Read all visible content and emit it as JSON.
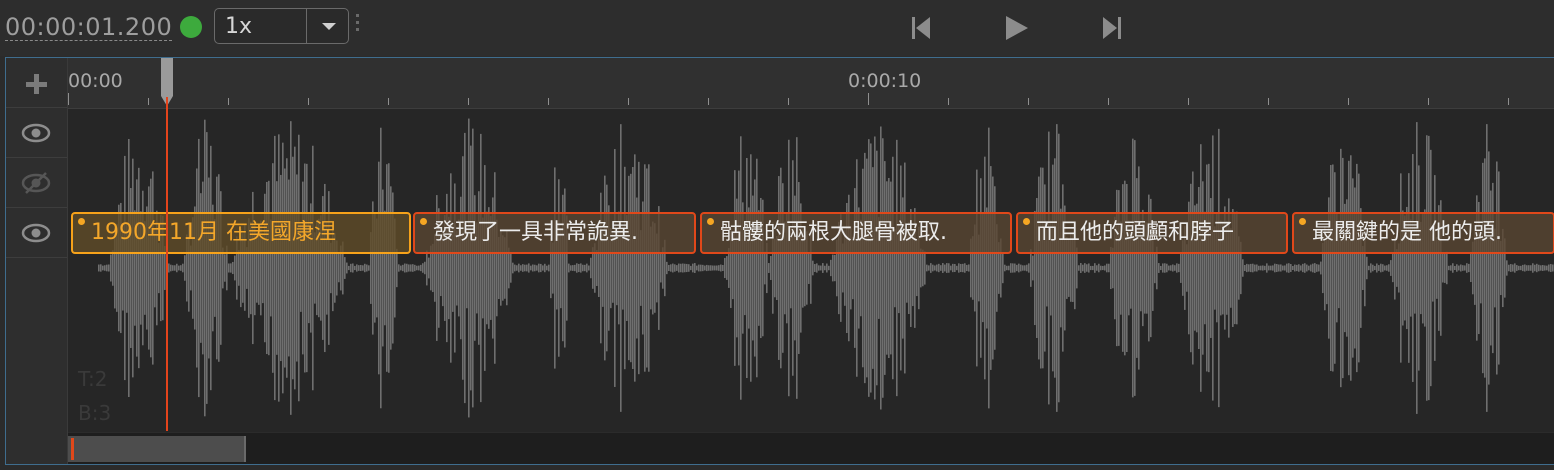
{
  "toolbar": {
    "timecode": "00:00:01.200",
    "status_color": "#3daa3d",
    "speed": {
      "selected": "1x",
      "options": [
        "1x"
      ]
    },
    "transport": [
      "skip-back-icon",
      "play-icon",
      "skip-forward-icon"
    ]
  },
  "timeline": {
    "ruler_labels": [
      "00:00",
      "0:00:10"
    ],
    "left_icons": [
      "add-track-icon",
      "eye-icon",
      "eye-off-icon",
      "eye-icon"
    ],
    "subtitles": [
      {
        "text": "1990年11月 在美國康涅",
        "active": true
      },
      {
        "text": "發現了一具非常詭異.",
        "active": false
      },
      {
        "text": "骷髏的兩根大腿骨被取.",
        "active": false
      },
      {
        "text": "而且他的頭顱和脖子",
        "active": false
      },
      {
        "text": "最關鍵的是 他的頭.",
        "active": false
      }
    ],
    "track_info": [
      "T:2",
      "B:3"
    ],
    "colors": {
      "playhead": "#e3441c",
      "subtitle_border": "#e0481a",
      "active_border": "#f7a21a",
      "frame": "#3f6d8e"
    }
  }
}
